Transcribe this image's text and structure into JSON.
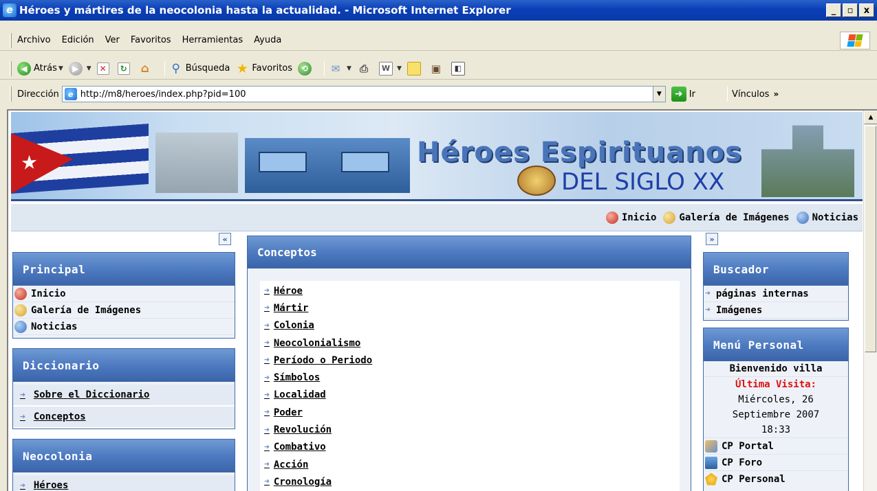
{
  "window": {
    "title": "Héroes y mártires de la neocolonia hasta la actualidad. - Microsoft Internet Explorer",
    "min": "_",
    "max": "▫",
    "close": "x"
  },
  "menu": {
    "items": [
      {
        "label": "Archivo"
      },
      {
        "label": "Edición"
      },
      {
        "label": "Ver"
      },
      {
        "label": "Favoritos"
      },
      {
        "label": "Herramientas"
      },
      {
        "label": "Ayuda"
      }
    ]
  },
  "toolbar": {
    "back": "Atrás",
    "search": "Búsqueda",
    "favorites": "Favoritos"
  },
  "address": {
    "label": "Dirección",
    "url": "http://m8/heroes/index.php?pid=100",
    "go": "Ir",
    "links": "Vínculos"
  },
  "banner": {
    "title": "Héroes Espirituanos",
    "subtitle": "DEL SIGLO XX"
  },
  "topnav": [
    {
      "label": "Inicio",
      "icon": "home-icon"
    },
    {
      "label": "Galería de Imágenes",
      "icon": "gallery-icon"
    },
    {
      "label": "Noticias",
      "icon": "news-icon"
    }
  ],
  "left": {
    "collapse": "«",
    "principal": {
      "title": "Principal",
      "items": [
        {
          "label": "Inicio",
          "icon": "home-icon"
        },
        {
          "label": "Galería de Imágenes",
          "icon": "gallery-icon"
        },
        {
          "label": "Noticias",
          "icon": "news-icon"
        }
      ]
    },
    "diccionario": {
      "title": "Diccionario",
      "items": [
        {
          "label": "Sobre el Diccionario"
        },
        {
          "label": "Conceptos"
        }
      ]
    },
    "neocolonia": {
      "title": "Neocolonia",
      "items": [
        {
          "label": "Héroes"
        }
      ]
    }
  },
  "center": {
    "title": "Conceptos",
    "items": [
      {
        "label": "Héroe"
      },
      {
        "label": "Mártir"
      },
      {
        "label": "Colonia"
      },
      {
        "label": "Neocolonialismo"
      },
      {
        "label": "Período o Periodo"
      },
      {
        "label": "Símbolos"
      },
      {
        "label": "Localidad"
      },
      {
        "label": "Poder"
      },
      {
        "label": "Revolución"
      },
      {
        "label": "Combativo"
      },
      {
        "label": "Acción"
      },
      {
        "label": "Cronología"
      }
    ]
  },
  "right": {
    "collapse": "»",
    "buscador": {
      "title": "Buscador",
      "items": [
        {
          "label": "páginas internas"
        },
        {
          "label": "Imágenes"
        }
      ]
    },
    "personal": {
      "title": "Menú Personal",
      "welcome": "Bienvenido villa",
      "last_visit_label": "Última Visita:",
      "date_line1": "Miércoles, 26",
      "date_line2": "Septiembre 2007",
      "time": "18:33",
      "items": [
        {
          "label": "CP Portal"
        },
        {
          "label": "CP Foro"
        },
        {
          "label": "CP Personal"
        }
      ]
    }
  }
}
